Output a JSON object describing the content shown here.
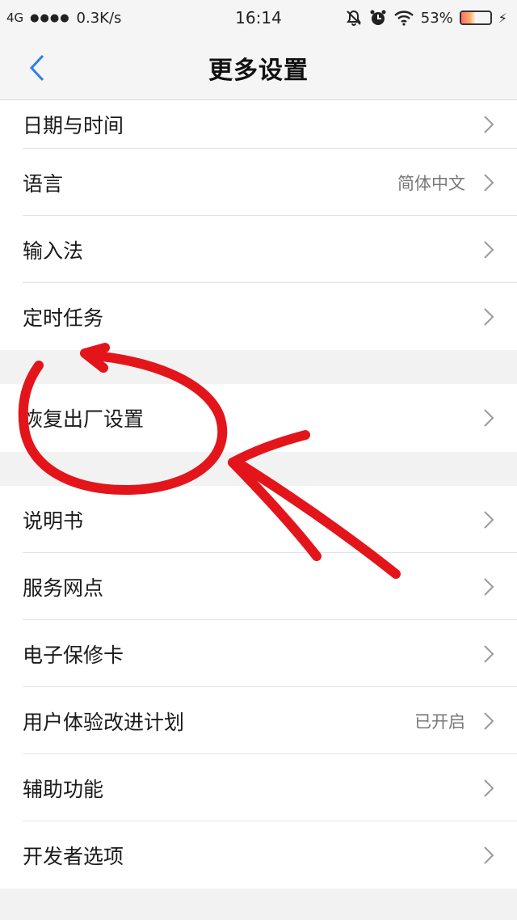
{
  "status_bar": {
    "network": "4G",
    "signal_dots": "●●●●",
    "speed": "0.3K/s",
    "time": "16:14",
    "battery_percent": "53%",
    "battery_level": 0.53,
    "icons": [
      "mute-bell-icon",
      "alarm-icon",
      "wifi-icon",
      "battery-icon",
      "charging-bolt-icon"
    ]
  },
  "nav": {
    "title": "更多设置",
    "back_icon": "chevron-left-icon"
  },
  "groups": [
    {
      "items": [
        {
          "label": "日期与时间",
          "value": ""
        },
        {
          "label": "语言",
          "value": "简体中文"
        },
        {
          "label": "输入法",
          "value": ""
        },
        {
          "label": "定时任务",
          "value": ""
        }
      ]
    },
    {
      "items": [
        {
          "label": "恢复出厂设置",
          "value": ""
        }
      ]
    },
    {
      "items": [
        {
          "label": "说明书",
          "value": ""
        },
        {
          "label": "服务网点",
          "value": ""
        },
        {
          "label": "电子保修卡",
          "value": ""
        },
        {
          "label": "用户体验改进计划",
          "value": "已开启"
        },
        {
          "label": "辅助功能",
          "value": ""
        },
        {
          "label": "开发者选项",
          "value": ""
        }
      ]
    }
  ],
  "colors": {
    "accent": "#2f7ee6",
    "annotation": "#e3151b",
    "chevron": "#9a9a9a"
  }
}
